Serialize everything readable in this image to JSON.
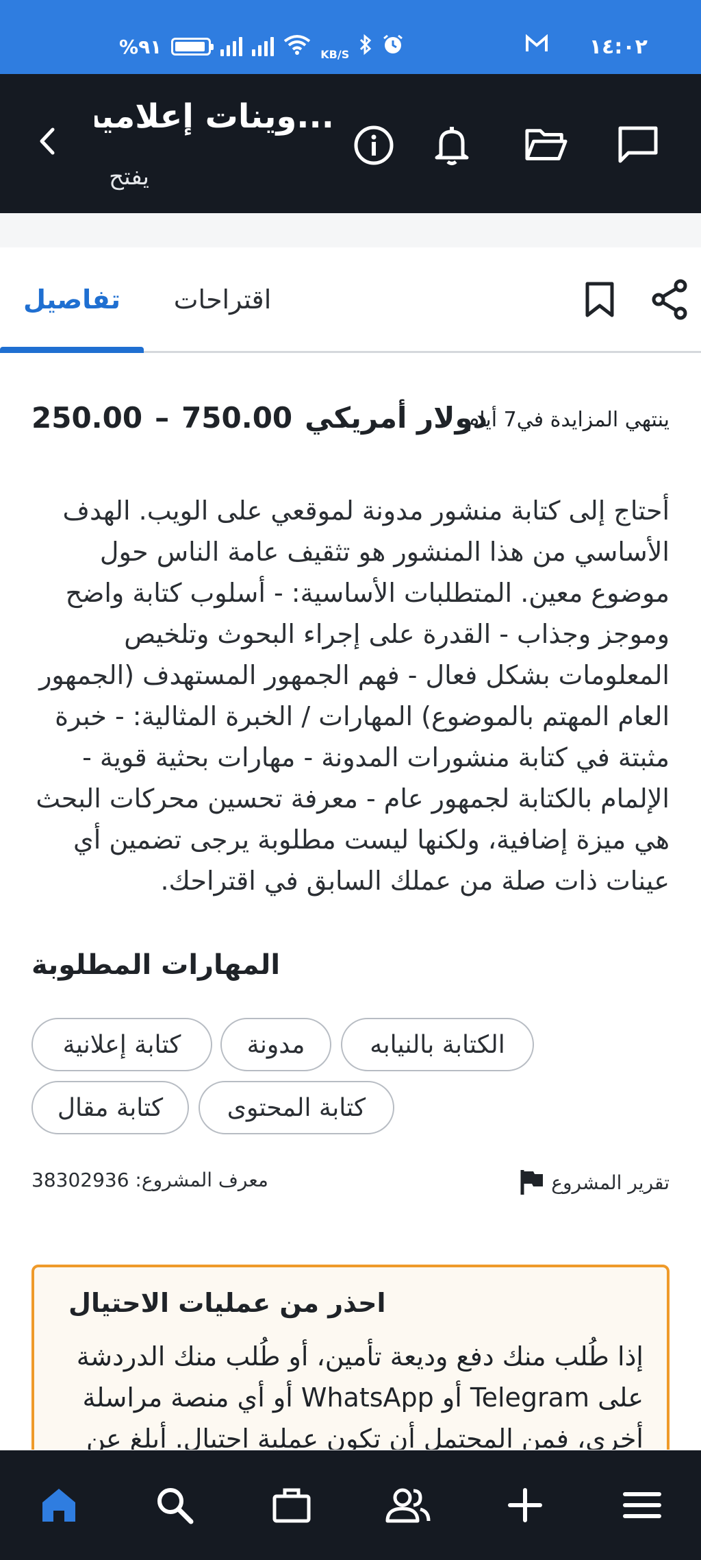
{
  "status_bar": {
    "time": "١٤:٠٢",
    "battery": "%٩١",
    "network_speed": "KB/S"
  },
  "header": {
    "title": "...وينات إعلامية",
    "subtitle": "يفتح"
  },
  "tabs": [
    {
      "label": "تفاصيل",
      "active": true
    },
    {
      "label": "اقتراحات",
      "active": false
    }
  ],
  "project": {
    "budget_low": "250.00",
    "budget_dash": "–",
    "budget_high": "750.00",
    "currency": "دولار أمريكي",
    "ends_prefix": "ينتهي المزايدة في",
    "ends_days": "7",
    "ends_suffix": "أيام",
    "description": "أحتاج إلى كتابة منشور مدونة لموقعي على الويب. الهدف الأساسي من هذا المنشور هو تثقيف عامة الناس حول موضوع معين. المتطلبات الأساسية: - أسلوب كتابة واضح وموجز وجذاب - القدرة على إجراء البحوث وتلخيص المعلومات بشكل فعال - فهم الجمهور المستهدف (الجمهور العام المهتم بالموضوع) المهارات / الخبرة المثالية: - خبرة مثبتة في كتابة منشورات المدونة - مهارات بحثية قوية - الإلمام بالكتابة لجمهور عام - معرفة تحسين محركات البحث هي ميزة إضافية، ولكنها ليست مطلوبة يرجى تضمين أي عينات ذات صلة من عملك السابق في اقتراحك.",
    "skills_heading": "المهارات المطلوبة",
    "skills": [
      "الكتابة بالنيابه",
      "مدونة",
      "كتابة إعلانية",
      "كتابة المحتوى",
      "كتابة مقال"
    ],
    "project_id_label": "معرف المشروع:",
    "project_id": "38302936",
    "report_label": "تقرير المشروع"
  },
  "warning": {
    "title": "احذر من عمليات الاحتيال",
    "text": "إذا طُلب منك دفع وديعة تأمين، أو طُلب منك الدردشة على Telegram أو WhatsApp أو أي منصة مراسلة أخرى، فمن المحتمل أن تكون عملية احتيال. أبلغ عن"
  },
  "bottom_nav": [
    "home-icon",
    "search-icon",
    "briefcase-icon",
    "people-icon",
    "plus-icon",
    "menu-icon"
  ],
  "colors": {
    "status_bar": "#2f7de0",
    "header": "#151a22",
    "accent": "#1f6fd1",
    "warning_border": "#ef9a2a"
  }
}
